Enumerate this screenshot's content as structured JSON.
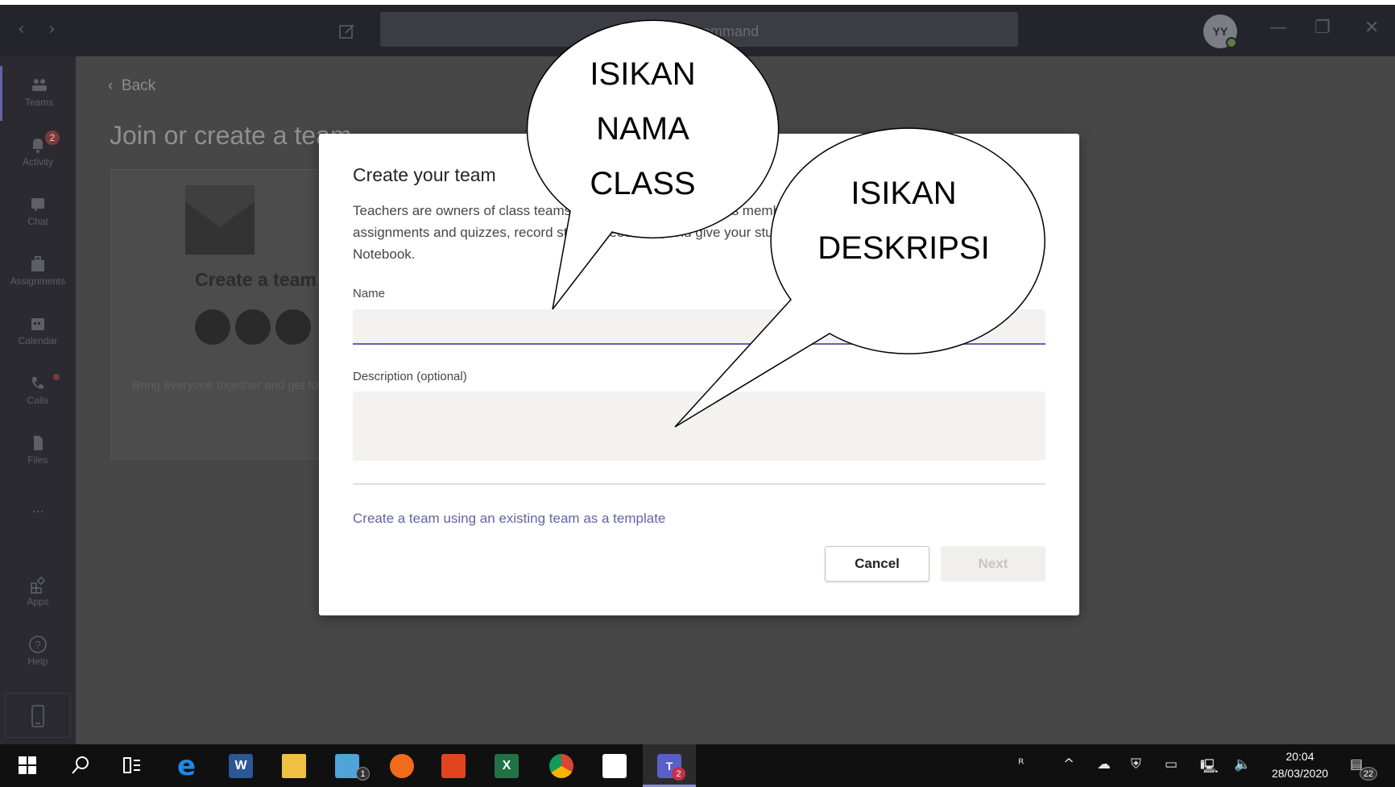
{
  "titlebar": {
    "search_placeholder": "Search or type a command",
    "search_visible_text": "ommand",
    "avatar_initials": "YY"
  },
  "rail": {
    "items": [
      {
        "label": "Teams",
        "icon": "teams-icon"
      },
      {
        "label": "Activity",
        "icon": "bell-icon",
        "badge": "2"
      },
      {
        "label": "Chat",
        "icon": "chat-icon"
      },
      {
        "label": "Assignments",
        "icon": "briefcase-icon"
      },
      {
        "label": "Calendar",
        "icon": "calendar-icon"
      },
      {
        "label": "Calls",
        "icon": "phone-icon"
      },
      {
        "label": "Files",
        "icon": "file-icon"
      },
      {
        "label": "...",
        "icon": "more-icon"
      },
      {
        "label": "Apps",
        "icon": "apps-icon"
      },
      {
        "label": "Help",
        "icon": "help-icon"
      }
    ]
  },
  "main": {
    "back_label": "Back",
    "page_title": "Join or create a team",
    "card_title": "Create a team",
    "card_desc": "Bring everyone together and get to work!"
  },
  "dialog": {
    "title": "Create your team",
    "description": "Teachers are owners of class teams and students participate as members. Each class team allows you to create assignments and quizzes, record student feedback, and give your students a private space for notes in Class Notebook.",
    "name_label": "Name",
    "name_value": "",
    "description_label": "Description (optional)",
    "description_value": "",
    "template_link": "Create a team using an existing team as a template",
    "cancel_label": "Cancel",
    "next_label": "Next"
  },
  "callouts": {
    "first": [
      "ISIKAN",
      "NAMA",
      "CLASS"
    ],
    "second": [
      "ISIKAN",
      "DESKRIPSI"
    ]
  },
  "taskbar": {
    "time": "20:04",
    "date": "28/03/2020",
    "mail_badge": "1",
    "teams_badge": "2",
    "notifications_badge": "22"
  },
  "colors": {
    "accent": "#6264a7",
    "overlay": "#474747",
    "titlebar": "#24242c"
  }
}
